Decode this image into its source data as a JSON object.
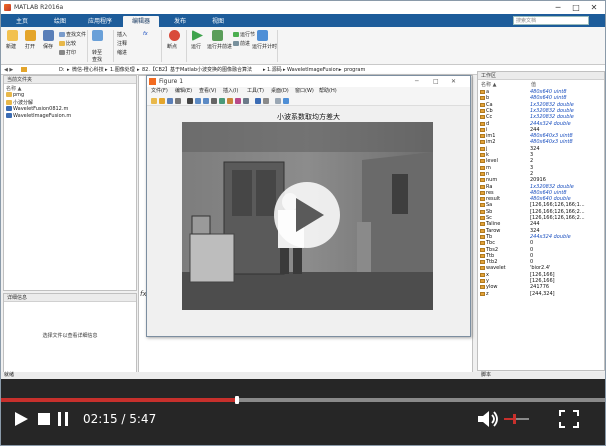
{
  "window": {
    "title": "MATLAB R2016a",
    "controls": {
      "minimize": "─",
      "maximize": "□",
      "close": "✕"
    }
  },
  "tabs": [
    {
      "label": "主页"
    },
    {
      "label": "绘图"
    },
    {
      "label": "应用程序"
    },
    {
      "label": "编辑器",
      "active": true
    },
    {
      "label": "发布"
    },
    {
      "label": "视图"
    }
  ],
  "search": {
    "placeholder": "搜索文档"
  },
  "ribbon": {
    "file": {
      "new": "新建",
      "open": "打开",
      "save": "保存",
      "find_files": "查找文件",
      "compare": "比较",
      "print": "打印"
    },
    "navigate": {
      "go_to": "转至",
      "find": "查找"
    },
    "edit": {
      "insert": "插入",
      "comment": "注释",
      "indent": "缩进",
      "fx": "fx"
    },
    "breakpoints": {
      "label": "断点"
    },
    "run": {
      "run": "运行",
      "run_advance": "运行并前进",
      "run_section": "运行节",
      "advance": "前进",
      "run_time": "运行并计时"
    }
  },
  "address": {
    "path": [
      "D:",
      "微信-橙心科技",
      "1.图像处理",
      "82.【CB2】基于Matlab小波变换的图像融合算法",
      "1.源码",
      "WaveletImageFusion",
      "program"
    ]
  },
  "current_folder": {
    "header": "当前文件夹",
    "col_name": "名称 ▲",
    "items": [
      {
        "name": "pmg",
        "type": "folder"
      },
      {
        "name": "小波分解",
        "type": "folder"
      },
      {
        "name": "WaveletFusion0812.m",
        "type": "m"
      },
      {
        "name": "WaveletImageFusion.m",
        "type": "m"
      }
    ]
  },
  "details": {
    "header": "详细信息",
    "message": "选择文件以查看详细信息"
  },
  "cmd_prompt": "fx",
  "figure": {
    "title": "Figure 1",
    "menu": [
      "文件(F)",
      "编辑(E)",
      "查看(V)",
      "插入(I)",
      "工具(T)",
      "桌面(D)",
      "窗口(W)",
      "帮助(H)"
    ],
    "plot_title": "小波系数取均方差大"
  },
  "workspace": {
    "header": "工作区",
    "col_name": "名称 ▲",
    "col_value": "值",
    "rows": [
      {
        "name": "a",
        "value": "480x640 uint8",
        "typed": true
      },
      {
        "name": "b",
        "value": "480x640 uint8",
        "typed": true
      },
      {
        "name": "Ca",
        "value": "1x320832 double",
        "typed": true
      },
      {
        "name": "Cb",
        "value": "1x320832 double",
        "typed": true
      },
      {
        "name": "Cc",
        "value": "1x320832 double",
        "typed": true
      },
      {
        "name": "d",
        "value": "244x324 double",
        "typed": true
      },
      {
        "name": "i",
        "value": "244",
        "typed": false
      },
      {
        "name": "im1",
        "value": "480x640x3 uint8",
        "typed": true
      },
      {
        "name": "im2",
        "value": "480x640x3 uint8",
        "typed": true
      },
      {
        "name": "j",
        "value": "324",
        "typed": false
      },
      {
        "name": "k",
        "value": "3",
        "typed": false
      },
      {
        "name": "level",
        "value": "2",
        "typed": false
      },
      {
        "name": "m",
        "value": "3",
        "typed": false
      },
      {
        "name": "n",
        "value": "2",
        "typed": false
      },
      {
        "name": "num",
        "value": "20916",
        "typed": false
      },
      {
        "name": "Ra",
        "value": "1x320832 double",
        "typed": true
      },
      {
        "name": "res",
        "value": "480x640 uint8",
        "typed": true
      },
      {
        "name": "result",
        "value": "480x640 double",
        "typed": true
      },
      {
        "name": "Sa",
        "value": "[126,166;126,166;1...",
        "typed": false
      },
      {
        "name": "Sb",
        "value": "[126,166;126,166;2...",
        "typed": false
      },
      {
        "name": "Sc",
        "value": "[126,166;126,166;2...",
        "typed": false
      },
      {
        "name": "Taline",
        "value": "244",
        "typed": false
      },
      {
        "name": "Tarow",
        "value": "324",
        "typed": false
      },
      {
        "name": "Tb",
        "value": "244x324 double",
        "typed": true
      },
      {
        "name": "Tbc",
        "value": "0",
        "typed": false
      },
      {
        "name": "Tbs2",
        "value": "0",
        "typed": false
      },
      {
        "name": "Ttb",
        "value": "0",
        "typed": false
      },
      {
        "name": "Ttb2",
        "value": "0",
        "typed": false
      },
      {
        "name": "wavelet",
        "value": "'bior2.4'",
        "typed": false
      },
      {
        "name": "x",
        "value": "[126,166]",
        "typed": false
      },
      {
        "name": "y",
        "value": "[126,166]",
        "typed": false
      },
      {
        "name": "ylow",
        "value": "241776",
        "typed": false
      },
      {
        "name": "z",
        "value": "[244,324]",
        "typed": false
      }
    ]
  },
  "status": {
    "left": "就绪",
    "right": "脚本"
  },
  "player": {
    "time": "02:15 / 5:47",
    "progress": 0.389,
    "volume": 0.35,
    "accent": "#c8302c"
  }
}
